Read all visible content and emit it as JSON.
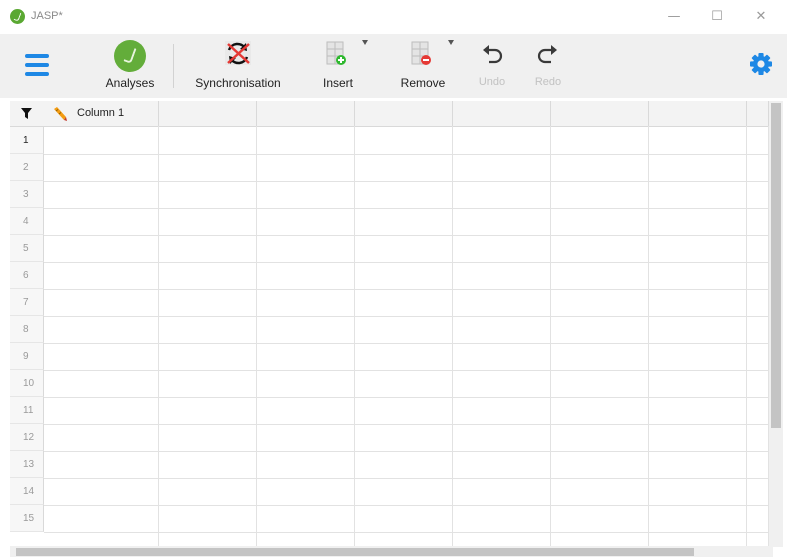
{
  "window": {
    "title": "JASP*",
    "minimize_glyph": "—",
    "maximize_glyph": "☐",
    "close_glyph": "✕"
  },
  "toolbar": {
    "analyses_label": "Analyses",
    "synchronisation_label": "Synchronisation",
    "insert_label": "Insert",
    "remove_label": "Remove",
    "undo_label": "Undo",
    "redo_label": "Redo",
    "undo_enabled": false,
    "redo_enabled": false,
    "icons": {
      "menu": "hamburger-menu-icon",
      "analyses": "analyses-icon",
      "synchronisation": "sync-disabled-icon",
      "insert": "insert-column-icon",
      "remove": "remove-column-icon",
      "undo": "undo-icon",
      "redo": "redo-icon",
      "settings": "gear-icon"
    },
    "colors": {
      "accent_blue": "#1e88e5",
      "analyses_green": "#63ad3a",
      "insert_green": "#2eb82e",
      "remove_red": "#e53935"
    }
  },
  "grid": {
    "filter_icon": "filter-icon",
    "column_type_icon": "scale-pencil-icon",
    "columns": [
      "Column 1",
      "",
      "",
      "",
      "",
      "",
      "",
      ""
    ],
    "rows": [
      "1",
      "2",
      "3",
      "4",
      "5",
      "6",
      "7",
      "8",
      "9",
      "10",
      "11",
      "12",
      "13",
      "14",
      "15"
    ]
  }
}
